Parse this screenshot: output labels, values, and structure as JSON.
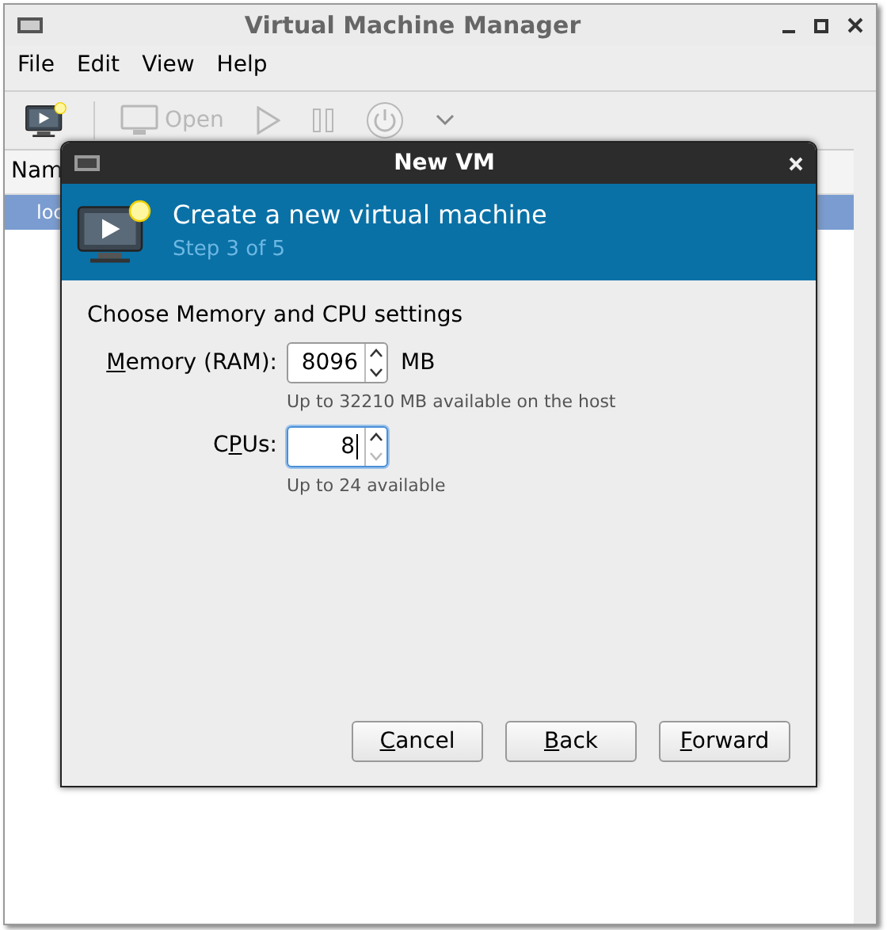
{
  "window": {
    "title": "Virtual Machine Manager"
  },
  "menu": [
    "File",
    "Edit",
    "View",
    "Help"
  ],
  "toolbar": [
    {
      "kind": "new",
      "disabled": false
    },
    {
      "kind": "open",
      "label": "Open",
      "disabled": true
    },
    {
      "kind": "run",
      "disabled": true
    },
    {
      "kind": "pause",
      "disabled": true
    },
    {
      "kind": "shutdown",
      "disabled": true
    },
    {
      "kind": "menu",
      "disabled": false
    }
  ],
  "list": {
    "column_1": "Nam",
    "rows": [
      {
        "cell": "loc",
        "selected": true
      }
    ]
  },
  "dialog": {
    "title": "New VM",
    "heading": "Create a new virtual machine",
    "step": "Step 3 of 5",
    "section": "Choose Memory and CPU settings",
    "fields": [
      {
        "label": {
          "key": "M",
          "after": "emory (RAM):"
        },
        "value": "8096",
        "unit": "MB",
        "hint": "Up to 32210 MB available on the host",
        "focused": false,
        "down_disabled": false
      },
      {
        "label": {
          "before": "C",
          "key": "P",
          "after": "Us:"
        },
        "value": "8",
        "hint": "Up to 24 available",
        "focused": true,
        "down_disabled": true
      }
    ],
    "buttons": [
      {
        "key": "C",
        "after": "ancel"
      },
      {
        "key": "B",
        "after": "ack"
      },
      {
        "key": "F",
        "after": "orward"
      }
    ]
  }
}
